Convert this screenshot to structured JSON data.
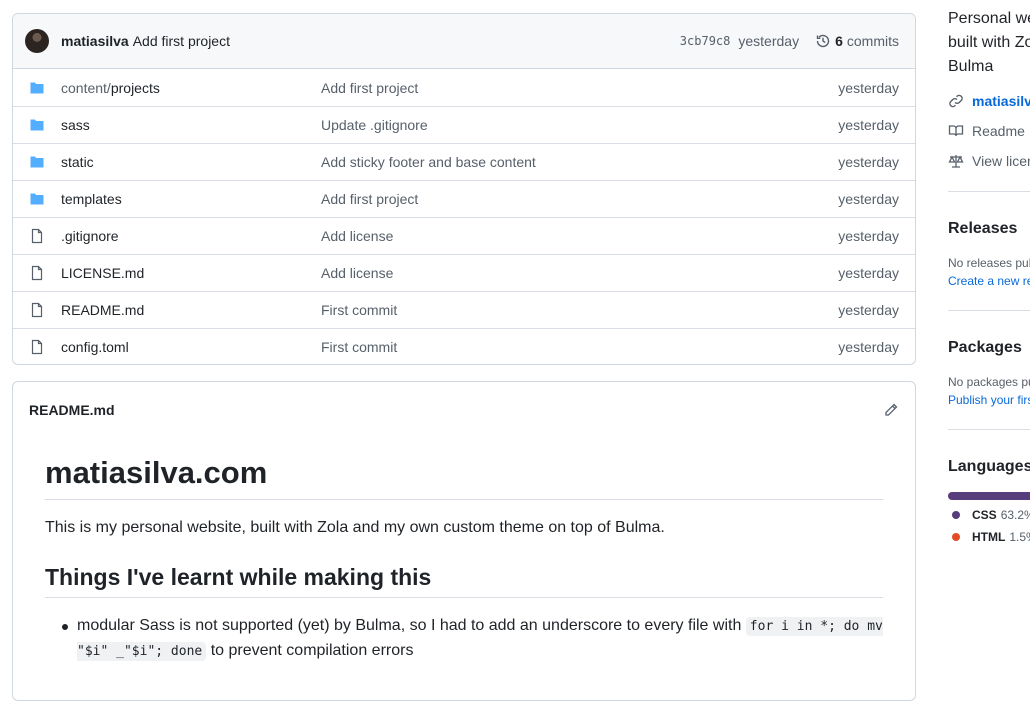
{
  "commit": {
    "author": "matiasilva",
    "message": "Add first project",
    "hash": "3cb79c8",
    "date": "yesterday",
    "commits_count": "6",
    "commits_label": "commits"
  },
  "files": [
    {
      "type": "folder",
      "prefix": "content/",
      "name": "projects",
      "message": "Add first project",
      "date": "yesterday"
    },
    {
      "type": "folder",
      "prefix": "",
      "name": "sass",
      "message": "Update .gitignore",
      "date": "yesterday"
    },
    {
      "type": "folder",
      "prefix": "",
      "name": "static",
      "message": "Add sticky footer and base content",
      "date": "yesterday"
    },
    {
      "type": "folder",
      "prefix": "",
      "name": "templates",
      "message": "Add first project",
      "date": "yesterday"
    },
    {
      "type": "file",
      "prefix": "",
      "name": ".gitignore",
      "message": "Add license",
      "date": "yesterday"
    },
    {
      "type": "file",
      "prefix": "",
      "name": "LICENSE.md",
      "message": "Add license",
      "date": "yesterday"
    },
    {
      "type": "file",
      "prefix": "",
      "name": "README.md",
      "message": "First commit",
      "date": "yesterday"
    },
    {
      "type": "file",
      "prefix": "",
      "name": "config.toml",
      "message": "First commit",
      "date": "yesterday"
    }
  ],
  "readme": {
    "filename": "README.md",
    "h1": "matiasilva.com",
    "intro": "This is my personal website, built with Zola and my own custom theme on top of Bulma.",
    "h2": "Things I've learnt while making this",
    "bullet_text": "modular Sass is not supported (yet) by Bulma, so I had to add an underscore to every file with",
    "bullet_code": "for i in *; do mv \"$i\" _\"$i\"; done",
    "bullet_tail": "to prevent compilation errors"
  },
  "sidebar": {
    "about": "Personal website built with Zola and Bulma",
    "url": "matiasilva.com",
    "readme_label": "Readme",
    "license_label": "View license",
    "releases_title": "Releases",
    "releases_none": "No releases published",
    "releases_link": "Create a new release",
    "packages_title": "Packages",
    "packages_none": "No packages published",
    "packages_link": "Publish your first package",
    "languages_title": "Languages",
    "languages": [
      {
        "name": "CSS",
        "pct": "63.2%",
        "color": "#563d7c"
      },
      {
        "name": "HTML",
        "pct": "1.5%",
        "color": "#e34c26"
      }
    ]
  }
}
